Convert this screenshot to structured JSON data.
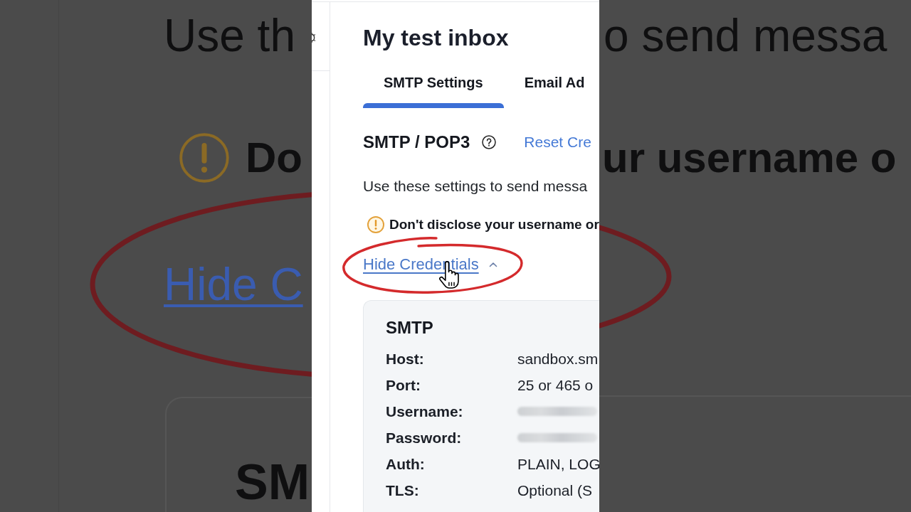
{
  "backdrop": {
    "left": {
      "description": "Use th",
      "warning": "Do",
      "link": "Hide C",
      "card_title": "SM"
    },
    "right": {
      "description": "o send messa",
      "warning": "ur username o"
    }
  },
  "panel": {
    "title": "My test inbox",
    "tabs": [
      {
        "label": "SMTP Settings",
        "selected": true
      },
      {
        "label": "Email Ad",
        "selected": false
      }
    ],
    "section": {
      "title": "SMTP / POP3",
      "link": "Reset Cre"
    },
    "description": "Use these settings to send messa",
    "warning": "Don't disclose your username or",
    "credentials_toggle": {
      "label": "Hide Credentials",
      "expanded": true
    },
    "credentials": {
      "title": "SMTP",
      "rows": [
        {
          "label": "Host:",
          "value": "sandbox.sm",
          "redacted": false
        },
        {
          "label": "Port:",
          "value": "25 or 465 o",
          "redacted": false
        },
        {
          "label": "Username:",
          "redacted": true
        },
        {
          "label": "Password:",
          "redacted": true
        },
        {
          "label": "Auth:",
          "value": "PLAIN, LOG",
          "redacted": false
        },
        {
          "label": "TLS:",
          "value": "Optional (S",
          "redacted": false
        }
      ]
    }
  }
}
